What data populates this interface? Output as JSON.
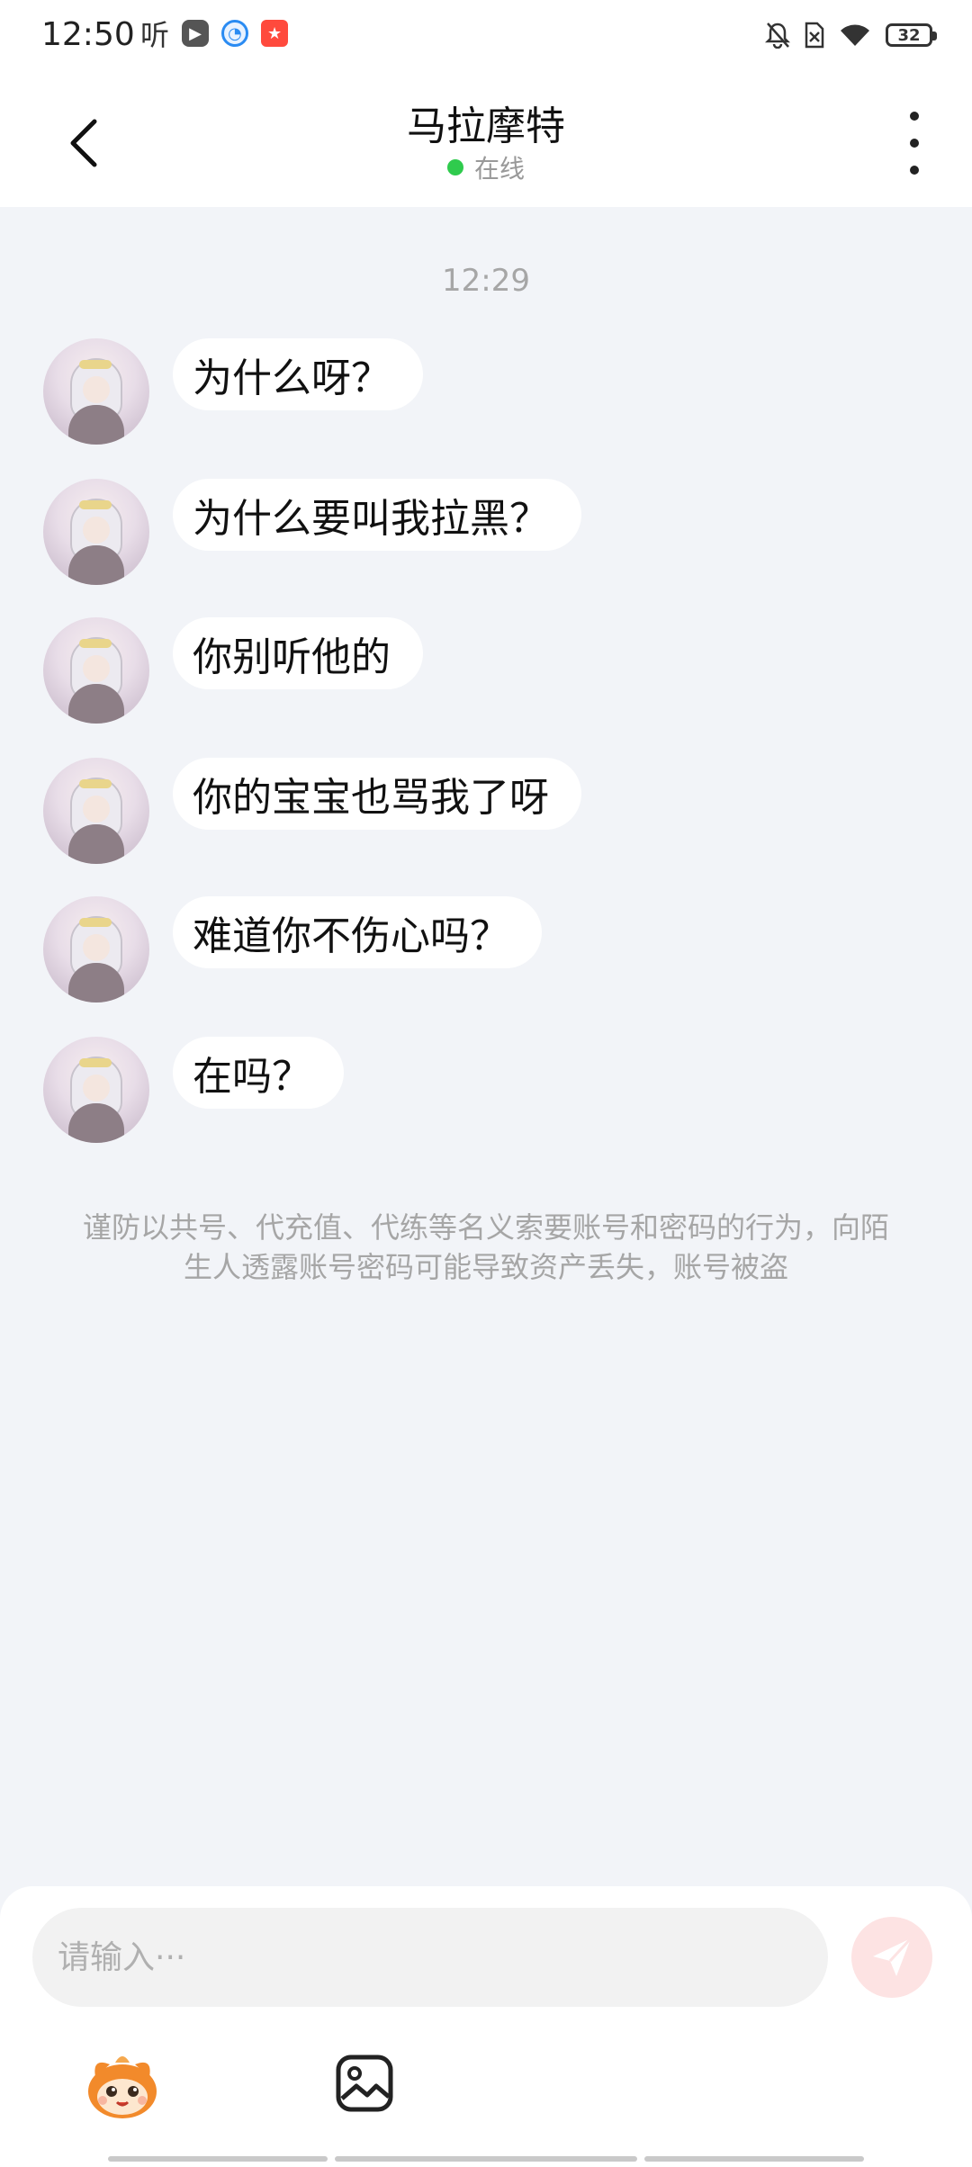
{
  "status_bar": {
    "time": "12:50",
    "listen_label": "听",
    "battery": "32",
    "icons": [
      "listen-icon",
      "video-player-icon",
      "browser-icon",
      "shopping-app-icon",
      "bell-off-icon",
      "sim-off-icon",
      "wifi-icon",
      "battery-icon"
    ]
  },
  "header": {
    "title": "马拉摩特",
    "presence": "在线",
    "presence_color": "#2fcb4d",
    "icons": [
      "back-icon",
      "more-icon"
    ]
  },
  "chat": {
    "timestamp": "12:29",
    "messages": [
      {
        "text": "为什么呀？"
      },
      {
        "text": "为什么要叫我拉黑？"
      },
      {
        "text": "你别听他的"
      },
      {
        "text": "你的宝宝也骂我了呀"
      },
      {
        "text": "难道你不伤心吗？"
      },
      {
        "text": "在吗？"
      }
    ],
    "notice": "谨防以共号、代充值、代练等名义索要账号和密码的行为，向陌生人透露账号密码可能导致资产丢失，账号被盗"
  },
  "composer": {
    "placeholder": "请输入···",
    "value": "",
    "icons": [
      "send-icon",
      "emoji-icon",
      "image-icon"
    ],
    "send_color": "#fde3e3"
  }
}
